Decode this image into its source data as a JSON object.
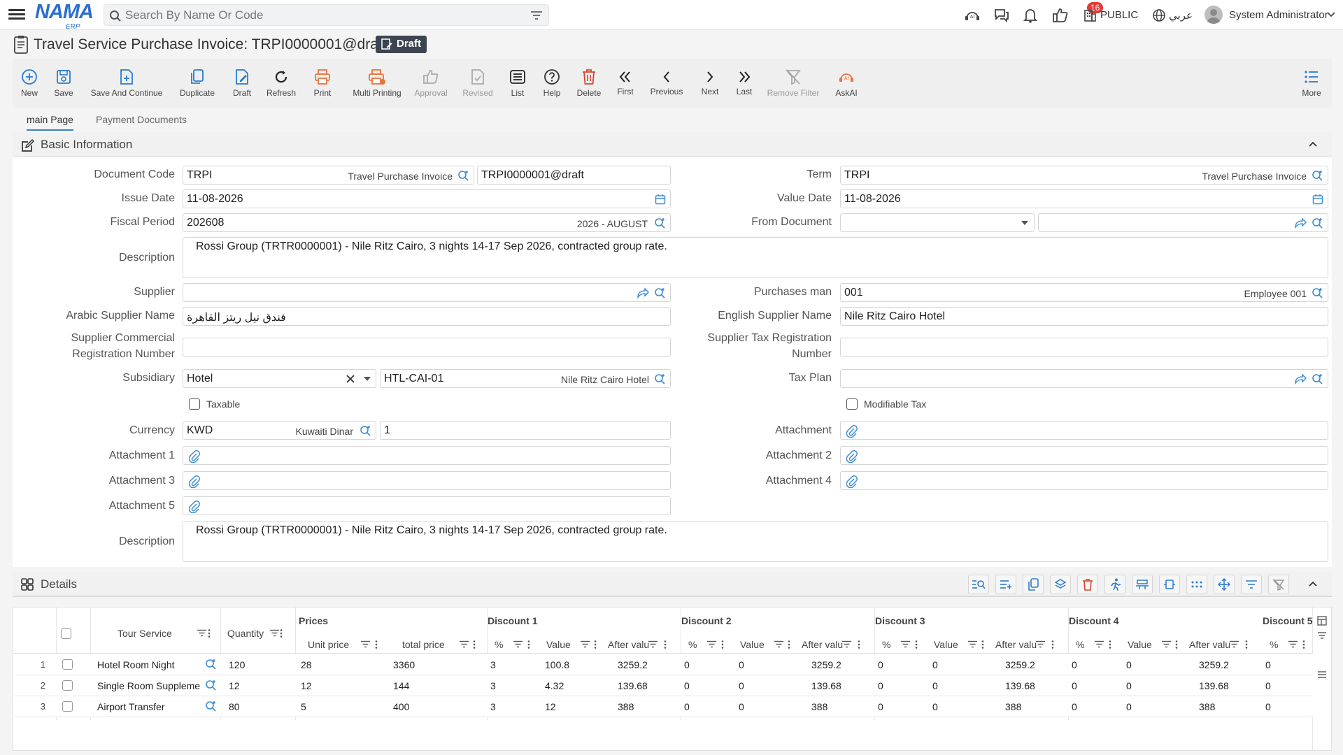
{
  "header": {
    "search_placeholder": "Search By Name Or Code",
    "notification_count": "16",
    "branch": "PUBLIC",
    "language": "عربي",
    "user": "System Administrator"
  },
  "page": {
    "title": "Travel Service Purchase Invoice: TRPI0000001@draft",
    "status": "Draft"
  },
  "toolbar": {
    "new": "New",
    "save": "Save",
    "save_continue": "Save And Continue",
    "duplicate": "Duplicate",
    "draft": "Draft",
    "refresh": "Refresh",
    "print": "Print",
    "multi_printing": "Multi Printing",
    "approval": "Approval",
    "revised": "Revised",
    "list": "List",
    "help": "Help",
    "delete": "Delete",
    "first": "First",
    "previous": "Previous",
    "next": "Next",
    "last": "Last",
    "remove_filter": "Remove Filter",
    "askai": "AskAI",
    "more": "More"
  },
  "tabs": {
    "main": "main Page",
    "payment": "Payment Documents"
  },
  "basic": {
    "section_title": "Basic Information",
    "labels": {
      "document_code": "Document Code",
      "issue_date": "Issue Date",
      "fiscal_period": "Fiscal Period",
      "description": "Description",
      "supplier": "Supplier",
      "arabic_supplier": "Arabic Supplier Name",
      "supplier_cr": "Supplier Commercial Registration Number",
      "subsidiary": "Subsidiary",
      "currency": "Currency",
      "attachment1": "Attachment 1",
      "attachment2": "Attachment 2",
      "attachment3": "Attachment 3",
      "attachment4": "Attachment 4",
      "attachment5": "Attachment 5",
      "term": "Term",
      "value_date": "Value Date",
      "from_document": "From Document",
      "purchases_man": "Purchases man",
      "english_supplier": "English Supplier Name",
      "supplier_tax": "Supplier Tax Registration Number",
      "tax_plan": "Tax Plan",
      "attachment": "Attachment",
      "taxable": "Taxable",
      "modifiable_tax": "Modifiable Tax"
    },
    "values": {
      "doc_code": "TRPI",
      "doc_code_name": "Travel Purchase Invoice",
      "doc_number": "TRPI0000001@draft",
      "issue_date": "11-08-2026",
      "fiscal_period": "202608",
      "fiscal_period_name": "2026 - AUGUST",
      "description": "Rossi Group (TRTR0000001) - Nile Ritz Cairo, 3 nights 14-17 Sep 2026, contracted group rate.",
      "arabic_supplier": "فندق نيل ريتز القاهرة",
      "subsidiary": "Hotel",
      "subsidiary_code": "HTL-CAI-01",
      "subsidiary_name": "Nile Ritz Cairo Hotel",
      "currency": "KWD",
      "currency_name": "Kuwaiti Dinar",
      "rate": "1",
      "term": "TRPI",
      "term_name": "Travel Purchase Invoice",
      "value_date": "11-08-2026",
      "purchases_man": "001",
      "purchases_man_name": "Employee 001",
      "english_supplier": "Nile Ritz Cairo Hotel",
      "description2": "Rossi Group (TRTR0000001) - Nile Ritz Cairo, 3 nights 14-17 Sep 2026, contracted group rate."
    }
  },
  "details": {
    "section_title": "Details",
    "headers": {
      "tour_service": "Tour Service",
      "quantity": "Quantity",
      "prices": "Prices",
      "unit_price": "Unit price",
      "total_price": "total price",
      "discount1": "Discount 1",
      "discount2": "Discount 2",
      "discount3": "Discount 3",
      "discount4": "Discount 4",
      "discount5": "Discount 5",
      "pct": "%",
      "value": "Value",
      "after_value": "After valu"
    },
    "rows": [
      {
        "n": "1",
        "service": "Hotel Room Night",
        "qty": "120",
        "unit": "28",
        "total": "3360",
        "d1p": "3",
        "d1v": "100.8",
        "d1a": "3259.2",
        "d2p": "0",
        "d2v": "0",
        "d2a": "3259.2",
        "d3p": "0",
        "d3v": "0",
        "d3a": "3259.2",
        "d4p": "0",
        "d4v": "0",
        "d4a": "3259.2",
        "d5p": "0"
      },
      {
        "n": "2",
        "service": "Single Room Suppleme",
        "qty": "12",
        "unit": "12",
        "total": "144",
        "d1p": "3",
        "d1v": "4.32",
        "d1a": "139.68",
        "d2p": "0",
        "d2v": "0",
        "d2a": "139.68",
        "d3p": "0",
        "d3v": "0",
        "d3a": "139.68",
        "d4p": "0",
        "d4v": "0",
        "d4a": "139.68",
        "d5p": "0"
      },
      {
        "n": "3",
        "service": "Airport Transfer",
        "qty": "80",
        "unit": "5",
        "total": "400",
        "d1p": "3",
        "d1v": "12",
        "d1a": "388",
        "d2p": "0",
        "d2v": "0",
        "d2a": "388",
        "d3p": "0",
        "d3v": "0",
        "d3a": "388",
        "d4p": "0",
        "d4v": "0",
        "d4a": "388",
        "d5p": "0"
      }
    ]
  }
}
